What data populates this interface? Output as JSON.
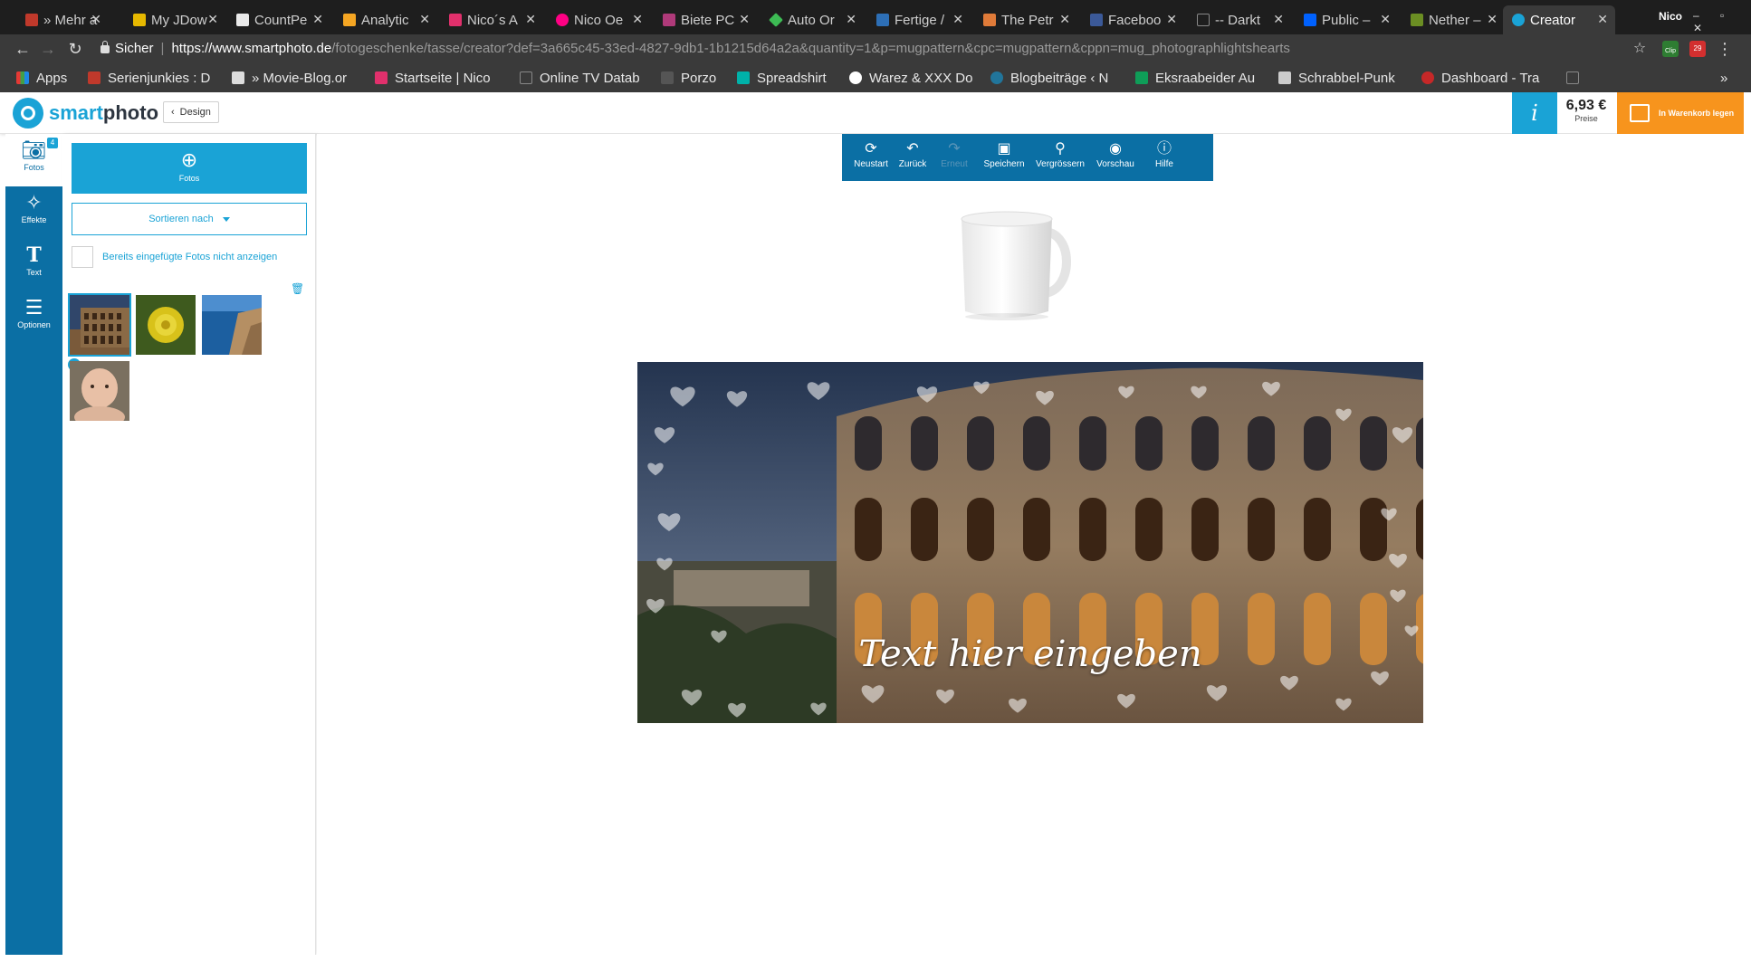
{
  "browser": {
    "tabs": [
      {
        "title": "» Mehr a",
        "favicon": "site-favicon-serienjunkies"
      },
      {
        "title": "My JDow",
        "favicon": "jdownloader-icon"
      },
      {
        "title": "CountPe",
        "favicon": "site-favicon"
      },
      {
        "title": "Analytic",
        "favicon": "analytics-icon"
      },
      {
        "title": "Nico´s A",
        "favicon": "camera-icon"
      },
      {
        "title": "Nico Oe",
        "favicon": "flickr-icon"
      },
      {
        "title": "Biete PC",
        "favicon": "site-favicon"
      },
      {
        "title": "Auto Or",
        "favicon": "site-favicon"
      },
      {
        "title": "Fertige /",
        "favicon": "dd-icon"
      },
      {
        "title": "The Petr",
        "favicon": "site-favicon"
      },
      {
        "title": "Faceboo",
        "favicon": "facebook-icon"
      },
      {
        "title": "-- Darkt",
        "favicon": "page-icon"
      },
      {
        "title": "Public –",
        "favicon": "dropbox-icon"
      },
      {
        "title": "Nether –",
        "favicon": "site-favicon"
      },
      {
        "title": "Creator",
        "favicon": "smartphoto-icon"
      }
    ],
    "profile_name": "Nico",
    "secure_label": "Sicher",
    "url_origin": "https://www.smartphoto.de",
    "url_path": "/fotogeschenke/tasse/creator?def=3a665c45-33ed-4827-9db1-1b1215d64a2a&quantity=1&p=mugpattern&cpc=mugpattern&cppn=mug_photographlightshearts",
    "extension_badge": "29",
    "extension_clip_label": "Clip",
    "bookmarks": [
      "Apps",
      "Serienjunkies : D",
      "» Movie-Blog.or",
      "Startseite | Nico",
      "Online TV Datab",
      "Porzo",
      "Spreadshirt",
      "Warez & XXX Do",
      "Blogbeiträge ‹ N",
      "Eksraabeider Au",
      "Schrabbel-Punk",
      "Dashboard - Tra"
    ],
    "bookmarks_overflow": "»"
  },
  "app": {
    "logo_part1": "smart",
    "logo_part2": "photo",
    "back_label": "Design",
    "info_label": "i",
    "price_value": "6,93 €",
    "price_label": "Preise",
    "cart_label": "In Warenkorb legen"
  },
  "rail": {
    "items": [
      {
        "label": "Fotos",
        "icon": "camera-icon"
      },
      {
        "label": "Effekte",
        "icon": "magic-wand-icon"
      },
      {
        "label": "Text",
        "icon": "text-icon"
      },
      {
        "label": "Optionen",
        "icon": "list-icon"
      }
    ],
    "photo_count": "4"
  },
  "panel": {
    "upload_label": "Fotos",
    "sort_label": "Sortieren nach",
    "hide_used_label": "Bereits eingefügte Fotos nicht anzeigen"
  },
  "toolbar": {
    "tools": [
      {
        "label": "Neustart",
        "icon": "refresh-icon",
        "enabled": true
      },
      {
        "label": "Zurück",
        "icon": "undo-icon",
        "enabled": true
      },
      {
        "label": "Erneut",
        "icon": "redo-icon",
        "enabled": false
      },
      {
        "label": "Speichern",
        "icon": "save-icon",
        "enabled": true
      },
      {
        "label": "Vergrössern",
        "icon": "zoom-icon",
        "enabled": true
      },
      {
        "label": "Vorschau",
        "icon": "eye-icon",
        "enabled": true
      },
      {
        "label": "Hilfe",
        "icon": "help-icon",
        "enabled": true
      }
    ]
  },
  "design": {
    "placeholder_text": "Text hier eingeben"
  },
  "colors": {
    "brand_blue": "#1aa3d6",
    "rail_blue": "#0b6fa4",
    "cart_orange": "#f7941d"
  }
}
